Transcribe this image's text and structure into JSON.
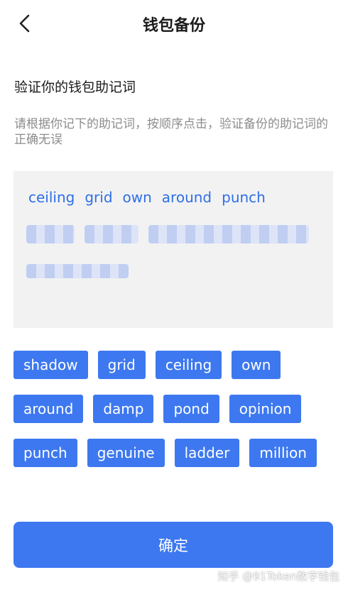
{
  "header": {
    "title": "钱包备份",
    "back_icon": "chevron-left-icon"
  },
  "section": {
    "title": "验证你的钱包助记词",
    "instruction": "请根据你记下的助记词，按顺序点击，验证备份的助记词的正确无误"
  },
  "selected_words": [
    "ceiling",
    "grid",
    "own",
    "around",
    "punch"
  ],
  "word_chips": [
    [
      "shadow",
      "grid",
      "ceiling",
      "own"
    ],
    [
      "around",
      "damp",
      "pond",
      "opinion"
    ],
    [
      "punch",
      "genuine",
      "ladder",
      "million"
    ]
  ],
  "confirm": {
    "label": "确定"
  },
  "watermark": "知乎 @91Token数字钱包",
  "colors": {
    "accent": "#3d78f0",
    "selected_text": "#2f6fe6",
    "panel_bg": "#f2f2f2",
    "muted_text": "#8c8c8c"
  }
}
